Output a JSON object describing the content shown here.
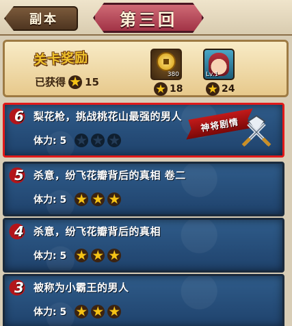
{
  "header": {
    "back_label": "副本",
    "title": "第三回"
  },
  "reward": {
    "title": "关卡奖励",
    "obtained_label": "已获得",
    "obtained_stars": "15",
    "items": [
      {
        "icon": "coin-icon",
        "count_label": "380",
        "star_count": "18"
      },
      {
        "icon": "hero-portrait",
        "level_label": "Lv.1",
        "star_count": "24"
      }
    ]
  },
  "stages": [
    {
      "number": "6",
      "name": "梨花枪，挑战桃花山最强的男人",
      "stamina": "体力: 5",
      "stars_earned": 0,
      "badge": "神将剧情",
      "selected": true
    },
    {
      "number": "5",
      "name": "杀意，纷飞花瓣背后的真相 卷二",
      "stamina": "体力: 5",
      "stars_earned": 3
    },
    {
      "number": "4",
      "name": "杀意，纷飞花瓣背后的真相",
      "stamina": "体力: 5",
      "stars_earned": 3
    },
    {
      "number": "3",
      "name": "被称为小霸王的男人",
      "stamina": "体力: 5",
      "stars_earned": 3
    }
  ],
  "colors": {
    "selected_border": "#e01a1a",
    "panel_blue": "#2f5c8a",
    "star_gold": "#f5c316"
  }
}
